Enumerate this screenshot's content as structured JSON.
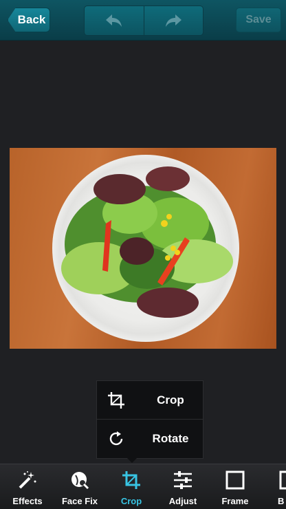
{
  "topbar": {
    "back_label": "Back",
    "save_label": "Save"
  },
  "popover": {
    "items": [
      {
        "label": "Crop",
        "icon": "crop-icon"
      },
      {
        "label": "Rotate",
        "icon": "rotate-icon"
      }
    ]
  },
  "toolbar": {
    "tools": [
      {
        "label": "Effects",
        "icon": "magic-wand-icon"
      },
      {
        "label": "Face Fix",
        "icon": "face-fix-icon"
      },
      {
        "label": "Crop",
        "icon": "crop-icon",
        "active": true
      },
      {
        "label": "Adjust",
        "icon": "sliders-icon"
      },
      {
        "label": "Frame",
        "icon": "frame-icon"
      },
      {
        "label": "B",
        "icon": "partial-icon"
      }
    ]
  },
  "colors": {
    "accent": "#38c4e3",
    "topbar": "#0e5562",
    "background": "#1f2023"
  }
}
